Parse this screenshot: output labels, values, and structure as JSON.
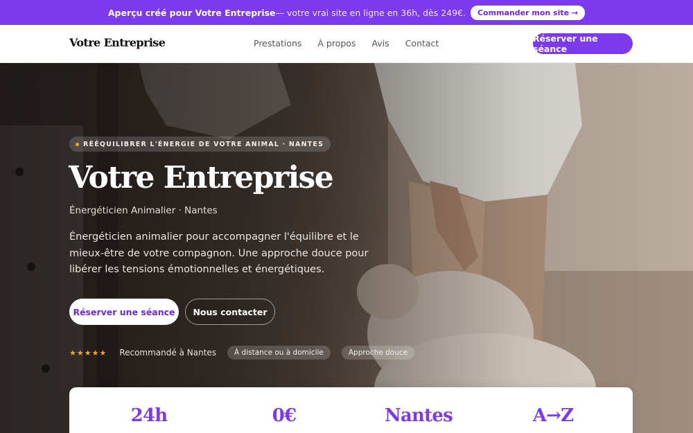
{
  "promo": {
    "highlight": "Aperçu créé pour Votre Entreprise",
    "text": " — votre vrai site en ligne en 36h, dès 249€.",
    "cta": "Commander mon site →"
  },
  "nav": {
    "brand": "Votre Entreprise",
    "links": [
      "Prestations",
      "À propos",
      "Avis",
      "Contact"
    ],
    "cta": "Réserver une séance"
  },
  "hero": {
    "tag": "RÉÉQUILIBRER L'ÉNERGIE DE VOTRE ANIMAL · NANTES",
    "title": "Votre Entreprise",
    "subtitle": "Énergéticien Animalier · Nantes",
    "description": "Énergéticien animalier pour accompagner l'équilibre et le mieux-être de votre compagnon. Une approche douce pour libérer les tensions émotionnelles et énergétiques.",
    "primary_cta": "Réserver une séance",
    "secondary_cta": "Nous contacter",
    "rating_stars": "★★★★★",
    "rating_text": "Recommandé à Nantes",
    "pills": [
      "À distance ou à domicile",
      "Approche douce"
    ]
  },
  "stats": [
    "24h",
    "0€",
    "Nantes",
    "A→Z"
  ],
  "colors": {
    "accent": "#7c3aed",
    "star": "#f5a524"
  }
}
